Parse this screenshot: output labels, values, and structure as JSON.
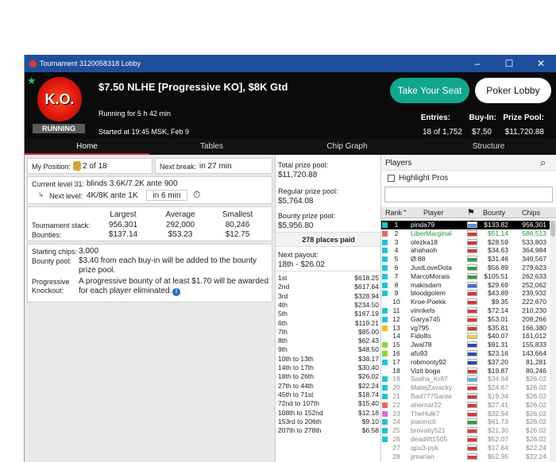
{
  "window": {
    "title": "Tournament 3120058318 Lobby",
    "controls": {
      "minimize": "–",
      "maximize": "☐",
      "close": "✕"
    }
  },
  "header": {
    "logo_text": "K.O.",
    "status": "RUNNING",
    "name": "$7.50 NLHE [Progressive KO], $8K Gtd",
    "running_for": "Running for 5 h 42 min",
    "started": "Started at 19:45 MSK, Feb 9",
    "take_seat": "Take Your Seat",
    "poker_lobby": "Poker Lobby",
    "entries_label": "Entries:",
    "entries_value": "18 of 1,752",
    "buyin_label": "Buy-In:",
    "buyin_value": "$7.50",
    "prizepool_label": "Prize Pool:",
    "prizepool_value": "$11,720.88"
  },
  "tabs": [
    "Home",
    "Tables",
    "Chip Graph",
    "Structure"
  ],
  "position": {
    "label": "My Position:",
    "value": "2 of 18"
  },
  "next_break": {
    "label": "Next break:",
    "value": "in 27 min"
  },
  "level": {
    "current_label": "Current level 31:",
    "current_value": "blinds 3.6K/7.2K ante 900",
    "next_label": "Next level:",
    "next_value": "4K/8K ante 1K",
    "next_time": "in 6 min"
  },
  "stats": {
    "headers": [
      "Largest",
      "Average",
      "Smallest"
    ],
    "stack_label": "Tournament stack:",
    "stack": [
      "956,301",
      "292,000",
      "80,246"
    ],
    "bounty_label": "Bounties:",
    "bounty": [
      "$137.14",
      "$53.23",
      "$12.75"
    ]
  },
  "info": {
    "starting_label": "Starting chips:",
    "starting_value": "3,000",
    "bounty_pool_label": "Bounty pool:",
    "bounty_pool_value": "$3.40 from each buy-in will be added to the bounty prize pool.",
    "pko_label_1": "Progressive",
    "pko_label_2": "Knockout:",
    "pko_value": "A progressive bounty of at least $1.70 will be awarded for each player eliminated."
  },
  "prizes": {
    "total_label": "Total prize pool:",
    "total_value": "$11,720.88",
    "regular_label": "Regular prize pool:",
    "regular_value": "$5,764.08",
    "bounty_label": "Bounty prize pool:",
    "bounty_value": "$5,956.80",
    "places_paid": "278 places paid",
    "next_payout_label": "Next payout:",
    "next_payout_value": "18th - $26.02",
    "rows": [
      {
        "place": "1st",
        "amount": "$618.25"
      },
      {
        "place": "2nd",
        "amount": "$617.64"
      },
      {
        "place": "3rd",
        "amount": "$328.94"
      },
      {
        "place": "4th",
        "amount": "$234.50"
      },
      {
        "place": "5th",
        "amount": "$167.19"
      },
      {
        "place": "6th",
        "amount": "$119.21"
      },
      {
        "place": "7th",
        "amount": "$85.00"
      },
      {
        "place": "8th",
        "amount": "$62.43"
      },
      {
        "place": "9th",
        "amount": "$48.50"
      },
      {
        "place": "10th to 13th",
        "amount": "$38.17"
      },
      {
        "place": "14th to 17th",
        "amount": "$30.40"
      },
      {
        "place": "18th to 26th",
        "amount": "$26.02"
      },
      {
        "place": "27th to 44th",
        "amount": "$22.24"
      },
      {
        "place": "45th to 71st",
        "amount": "$18.74"
      },
      {
        "place": "72nd to 107th",
        "amount": "$15.40"
      },
      {
        "place": "108th to 152nd",
        "amount": "$12.18"
      },
      {
        "place": "153rd to 206th",
        "amount": "$9.10"
      },
      {
        "place": "207th to 278th",
        "amount": "$6.58"
      }
    ]
  },
  "players": {
    "title": "Players",
    "highlight": "Highlight Pros",
    "search_placeholder": "",
    "col_rank": "Rank",
    "col_player": "Player",
    "col_bounty": "Bounty",
    "col_chips": "Chips",
    "rows": [
      {
        "rank": "1",
        "name": "pinda79",
        "bounty": "$133.82",
        "chips": "956,301",
        "status": "#22c3d6",
        "flag": "#5b8fd9",
        "selected": true
      },
      {
        "rank": "2",
        "name": "LiberMarginal",
        "bounty": "$51.14",
        "chips": "586,513",
        "status": "#e06a6a",
        "flag": "#d23a3a",
        "me": true
      },
      {
        "rank": "3",
        "name": "olezka18",
        "bounty": "$28.59",
        "chips": "533,803",
        "status": "#22c3d6",
        "flag": "#d23a3a"
      },
      {
        "rank": "4",
        "name": "ahahaoh",
        "bounty": "$34.63",
        "chips": "364,984",
        "status": "#22c3d6",
        "flag": "#d23a3a"
      },
      {
        "rank": "5",
        "name": "Ø 88",
        "bounty": "$31.46",
        "chips": "349,567",
        "status": "#22c3d6",
        "flag": "#2f9e44"
      },
      {
        "rank": "6",
        "name": "JustLoveDota",
        "bounty": "$56.89",
        "chips": "279,623",
        "status": "#22c3d6",
        "flag": "#2f9e44"
      },
      {
        "rank": "7",
        "name": "MarcoMorais",
        "bounty": "$105.51",
        "chips": "262,633",
        "status": "#22c3d6",
        "flag": "#2f9e44"
      },
      {
        "rank": "8",
        "name": "makisdam",
        "bounty": "$29.69",
        "chips": "252,062",
        "status": "#22c3d6",
        "flag": "#3f6fc9"
      },
      {
        "rank": "9",
        "name": "bloodgolem",
        "bounty": "$43.89",
        "chips": "239,932",
        "status": "#22c3d6",
        "flag": "#d23a3a"
      },
      {
        "rank": "10",
        "name": "Kroe-Poekk",
        "bounty": "$9.35",
        "chips": "222,670",
        "status": "",
        "flag": "#d23a3a"
      },
      {
        "rank": "11",
        "name": "vinnkels",
        "bounty": "$72.14",
        "chips": "210,230",
        "status": "#22c3d6",
        "flag": "#d23a3a"
      },
      {
        "rank": "12",
        "name": "Garya745",
        "bounty": "$53.01",
        "chips": "209,266",
        "status": "#22c3d6",
        "flag": "#d23a3a"
      },
      {
        "rank": "13",
        "name": "vg795",
        "bounty": "$35.81",
        "chips": "166,380",
        "status": "#e8c21a",
        "flag": "#d23a3a"
      },
      {
        "rank": "14",
        "name": "Fidolfo",
        "bounty": "$40.07",
        "chips": "161,012",
        "status": "",
        "flag": "#f2d23a"
      },
      {
        "rank": "15",
        "name": "Jwal78",
        "bounty": "$91.31",
        "chips": "155,833",
        "status": "#8ad63a",
        "flag": "#2c4aa8"
      },
      {
        "rank": "16",
        "name": "afu93",
        "bounty": "$23.16",
        "chips": "143,664",
        "status": "#8ad63a",
        "flag": "#2c4aa8"
      },
      {
        "rank": "17",
        "name": "robmonty92",
        "bounty": "$37.20",
        "chips": "81,281",
        "status": "#22c3d6",
        "flag": "#2c4aa8"
      },
      {
        "rank": "18",
        "name": "Vizit boga",
        "bounty": "$19.87",
        "chips": "80,246",
        "status": "",
        "flag": "#d23a3a"
      },
      {
        "rank": "19",
        "name": "Sasha_Kr87",
        "bounty": "$34.84",
        "chips": "$26.02",
        "status": "#22c3d6",
        "flag": "#5bb0e8",
        "out": true
      },
      {
        "rank": "20",
        "name": "MatejZavacky",
        "bounty": "$24.67",
        "chips": "$26.02",
        "status": "#22c3d6",
        "flag": "#d23a3a",
        "out": true
      },
      {
        "rank": "21",
        "name": "Bad777Santa",
        "bounty": "$19.34",
        "chips": "$26.02",
        "status": "#22c3d6",
        "flag": "#d23a3a",
        "out": true
      },
      {
        "rank": "22",
        "name": "ahernar22",
        "bounty": "$27.41",
        "chips": "$26.02",
        "status": "#e06a6a",
        "flag": "#d23a3a",
        "out": true
      },
      {
        "rank": "23",
        "name": "TheHulk7",
        "bounty": "$32.94",
        "chips": "$26.02",
        "status": "#d86ad6",
        "flag": "#d23a3a",
        "out": true
      },
      {
        "rank": "24",
        "name": "joaomclt",
        "bounty": "$61.73",
        "chips": "$26.02",
        "status": "#22c3d6",
        "flag": "#2f9e44",
        "out": true
      },
      {
        "rank": "25",
        "name": "brovatiy521",
        "bounty": "$21.30",
        "chips": "$26.02",
        "status": "#22c3d6",
        "flag": "#d23a3a",
        "out": true
      },
      {
        "rank": "26",
        "name": "deadlift1505",
        "bounty": "$52.07",
        "chips": "$26.02",
        "status": "#22c3d6",
        "flag": "#d23a3a",
        "out": true
      },
      {
        "rank": "27",
        "name": "qpu3-pyk",
        "bounty": "$17.64",
        "chips": "$22.24",
        "status": "",
        "flag": "#d23a3a",
        "out": true
      },
      {
        "rank": "28",
        "name": "jimarian",
        "bounty": "$52.95",
        "chips": "$22.24",
        "status": "",
        "flag": "#d23a3a",
        "out": true
      }
    ]
  },
  "colors": {
    "accent": "#12a68e",
    "titlebar": "#1f4f9c",
    "tab_active": "#d9232e",
    "me": "#1e9b31"
  }
}
